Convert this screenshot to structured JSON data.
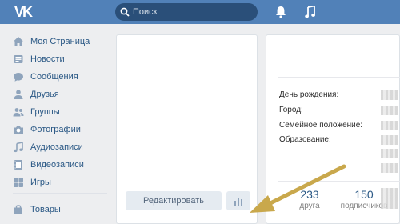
{
  "header": {
    "logo": "VK",
    "search_placeholder": "Поиск"
  },
  "sidebar": {
    "items": [
      {
        "label": "Моя Страница",
        "icon": "home-icon"
      },
      {
        "label": "Новости",
        "icon": "news-icon"
      },
      {
        "label": "Сообщения",
        "icon": "messages-icon"
      },
      {
        "label": "Друзья",
        "icon": "friends-icon"
      },
      {
        "label": "Группы",
        "icon": "groups-icon"
      },
      {
        "label": "Фотографии",
        "icon": "camera-icon"
      },
      {
        "label": "Аудиозаписи",
        "icon": "music-note-icon"
      },
      {
        "label": "Видеозаписи",
        "icon": "video-icon"
      },
      {
        "label": "Игры",
        "icon": "games-icon"
      },
      {
        "label": "Товары",
        "icon": "shopping-bag-icon"
      }
    ]
  },
  "profile": {
    "edit_label": "Редактировать",
    "stats_icon": "bar-chart-icon"
  },
  "info": {
    "rows": [
      {
        "label": "День рождения:"
      },
      {
        "label": "Город:"
      },
      {
        "label": "Семейное положение:"
      },
      {
        "label": "Образование:"
      }
    ],
    "counters": [
      {
        "value": "233",
        "label": "друга"
      },
      {
        "value": "150",
        "label": "подписчиков"
      }
    ]
  },
  "colors": {
    "header": "#5181b8",
    "link": "#2a5885",
    "annotation_arrow": "#c9a84c"
  }
}
